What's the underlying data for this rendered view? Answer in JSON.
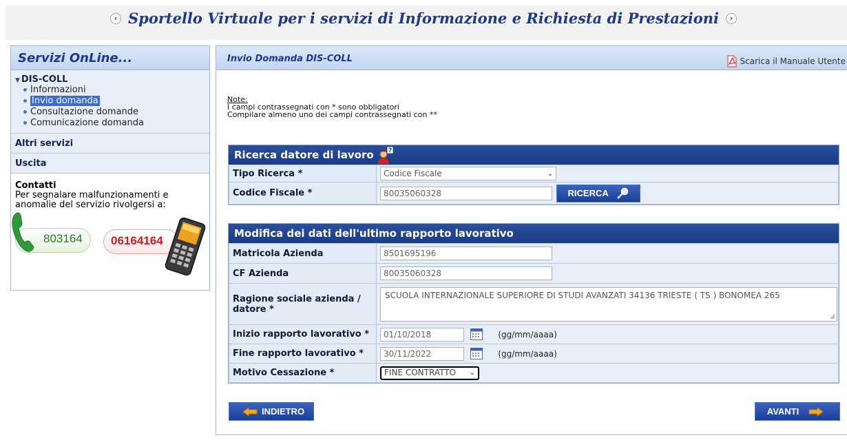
{
  "header": {
    "title": "Sportello Virtuale per i servizi di Informazione e Richiesta di Prestazioni",
    "prev_icon": "chevron-left-icon",
    "next_icon": "chevron-right-icon"
  },
  "sidebar": {
    "title": "Servizi OnLine...",
    "menu_title": "DIS-COLL",
    "items": [
      {
        "label": "Informazioni",
        "active": false
      },
      {
        "label": "Invio domanda",
        "active": true
      },
      {
        "label": "Consultazione domande",
        "active": false
      },
      {
        "label": "Comunicazione domanda",
        "active": false
      }
    ],
    "other_services": "Altri servizi",
    "exit": "Uscita",
    "contacts_title": "Contatti",
    "contacts_text": "Per segnalare malfunzionamenti e anomalie del servizio rivolgersi a:",
    "phone_landline": "803164",
    "phone_mobile": "06164164"
  },
  "main": {
    "title": "Invio Domanda DIS-COLL",
    "manual_link": "Scarica il Manuale Utente",
    "notes": {
      "title": "Note:",
      "line1": "I campi contrassegnati con * sono obbligatori",
      "line2": "Compilare almeno uno dei campi contrassegnati con **"
    },
    "search": {
      "title": "Ricerca datore di lavoro",
      "tipo_label": "Tipo Ricerca *",
      "tipo_value": "Codice Fiscale",
      "cf_label": "Codice Fiscale *",
      "cf_value": "80035060328",
      "search_button": "RICERCA"
    },
    "employment": {
      "title": "Modifica dei dati dell'ultimo rapporto lavorativo",
      "matricola_label": "Matricola Azienda",
      "matricola_value": "8501695196",
      "cf_azienda_label": "CF Azienda",
      "cf_azienda_value": "80035060328",
      "ragione_label": "Ragione sociale azienda / datore *",
      "ragione_value": "SCUOLA INTERNAZIONALE SUPERIORE DI STUDI AVANZATI 34136 TRIESTE ( TS ) BONOMEA 265",
      "inizio_label": "Inizio rapporto lavorativo *",
      "inizio_value": "01/10/2018",
      "fine_label": "Fine rapporto lavorativo *",
      "fine_value": "30/11/2022",
      "date_hint": "(gg/mm/aaaa)",
      "motivo_label": "Motivo Cessazione *",
      "motivo_value": "FINE CONTRATTO"
    },
    "back_button": "INDIETRO",
    "next_button": "AVANTI"
  }
}
